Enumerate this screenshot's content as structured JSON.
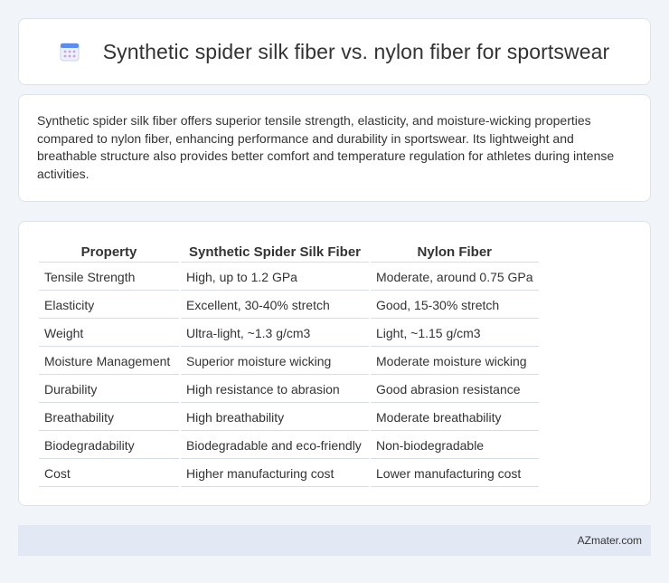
{
  "header": {
    "title": "Synthetic spider silk fiber vs. nylon fiber for sportswear",
    "icon": "calendar-grid-icon"
  },
  "summary": {
    "text": "Synthetic spider silk fiber offers superior tensile strength, elasticity, and moisture-wicking properties compared to nylon fiber, enhancing performance and durability in sportswear. Its lightweight and breathable structure also provides better comfort and temperature regulation for athletes during intense activities."
  },
  "table": {
    "headers": [
      "Property",
      "Synthetic Spider Silk Fiber",
      "Nylon Fiber"
    ],
    "rows": [
      [
        "Tensile Strength",
        "High, up to 1.2 GPa",
        "Moderate, around 0.75 GPa"
      ],
      [
        "Elasticity",
        "Excellent, 30-40% stretch",
        "Good, 15-30% stretch"
      ],
      [
        "Weight",
        "Ultra-light, ~1.3 g/cm3",
        "Light, ~1.15 g/cm3"
      ],
      [
        "Moisture Management",
        "Superior moisture wicking",
        "Moderate moisture wicking"
      ],
      [
        "Durability",
        "High resistance to abrasion",
        "Good abrasion resistance"
      ],
      [
        "Breathability",
        "High breathability",
        "Moderate breathability"
      ],
      [
        "Biodegradability",
        "Biodegradable and eco-friendly",
        "Non-biodegradable"
      ],
      [
        "Cost",
        "Higher manufacturing cost",
        "Lower manufacturing cost"
      ]
    ]
  },
  "footer": {
    "brand": "AZmater.com"
  },
  "colors": {
    "background": "#f1f4f9",
    "card": "#ffffff",
    "footer": "#e3e9f4",
    "icon_accent": "#5b8def"
  }
}
